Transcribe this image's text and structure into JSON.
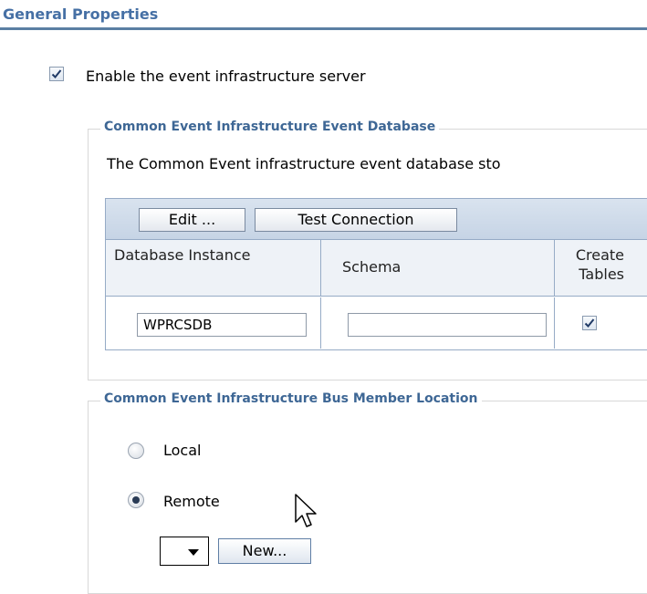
{
  "section": {
    "title": "General Properties"
  },
  "enable": {
    "label": "Enable the event infrastructure server",
    "checked": true
  },
  "database": {
    "legend": "Common Event Infrastructure Event Database",
    "description": "The Common Event infrastructure event database sto",
    "toolbar": {
      "edit_label": "Edit ...",
      "test_label": "Test Connection"
    },
    "columns": [
      "Database Instance",
      "Schema",
      "Create Tables"
    ],
    "row": {
      "instance": "WPRCSDB",
      "schema": "",
      "create_tables": true
    }
  },
  "bus": {
    "legend": "Common Event Infrastructure Bus Member Location",
    "options": [
      {
        "label": "Local",
        "selected": false
      },
      {
        "label": "Remote",
        "selected": true
      }
    ],
    "new_label": "New..."
  }
}
